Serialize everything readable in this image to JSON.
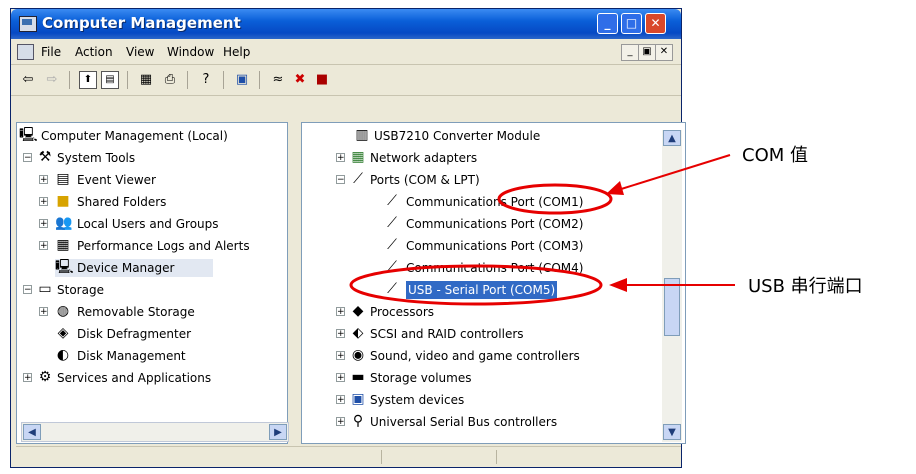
{
  "window": {
    "title": "Computer Management"
  },
  "menu": {
    "items": [
      "File",
      "Action",
      "View",
      "Window",
      "Help"
    ]
  },
  "toolbar": {
    "icons": [
      "back-arrow-icon",
      "forward-arrow-icon",
      "up-folder-icon",
      "show-hide-tree-icon",
      "properties-icon",
      "print-icon",
      "help-icon",
      "scan-hardware-icon",
      "update-driver-icon",
      "uninstall-icon",
      "disable-icon"
    ]
  },
  "left_tree": [
    {
      "label": "Computer Management (Local)",
      "icon": "computer-icon"
    },
    {
      "label": "System Tools",
      "icon": "tools-icon"
    },
    {
      "label": "Event Viewer",
      "icon": "event-viewer-icon"
    },
    {
      "label": "Shared Folders",
      "icon": "folder-icon"
    },
    {
      "label": "Local Users and Groups",
      "icon": "users-icon"
    },
    {
      "label": "Performance Logs and Alerts",
      "icon": "performance-icon"
    },
    {
      "label": "Device Manager",
      "icon": "device-manager-icon"
    },
    {
      "label": "Storage",
      "icon": "storage-icon"
    },
    {
      "label": "Removable Storage",
      "icon": "removable-storage-icon"
    },
    {
      "label": "Disk Defragmenter",
      "icon": "defragmenter-icon"
    },
    {
      "label": "Disk Management",
      "icon": "disk-management-icon"
    },
    {
      "label": "Services and Applications",
      "icon": "services-icon"
    }
  ],
  "right_tree": [
    {
      "label": "USB7210 Converter Module",
      "icon": "module-icon"
    },
    {
      "label": "Network adapters",
      "icon": "network-adapter-icon"
    },
    {
      "label": "Ports (COM & LPT)",
      "icon": "port-icon"
    },
    {
      "label": "Communications Port (COM1)",
      "icon": "port-icon"
    },
    {
      "label": "Communications Port (COM2)",
      "icon": "port-icon"
    },
    {
      "label": "Communications Port (COM3)",
      "icon": "port-icon"
    },
    {
      "label": "Communications Port (COM4)",
      "icon": "port-icon"
    },
    {
      "label": "USB - Serial Port (COM5)",
      "icon": "port-icon"
    },
    {
      "label": "Processors",
      "icon": "processor-icon"
    },
    {
      "label": "SCSI and RAID controllers",
      "icon": "scsi-icon"
    },
    {
      "label": "Sound, video and game controllers",
      "icon": "sound-icon"
    },
    {
      "label": "Storage volumes",
      "icon": "storage-volume-icon"
    },
    {
      "label": "System devices",
      "icon": "system-device-icon"
    },
    {
      "label": "Universal Serial Bus controllers",
      "icon": "usb-icon"
    }
  ],
  "annotations": {
    "com_value": "COM 值",
    "usb_serial_port": "USB 串行端口"
  },
  "colors": {
    "title_bar": "#0a5fd8",
    "annotation": "#e60000",
    "selection": "#316ac5"
  }
}
